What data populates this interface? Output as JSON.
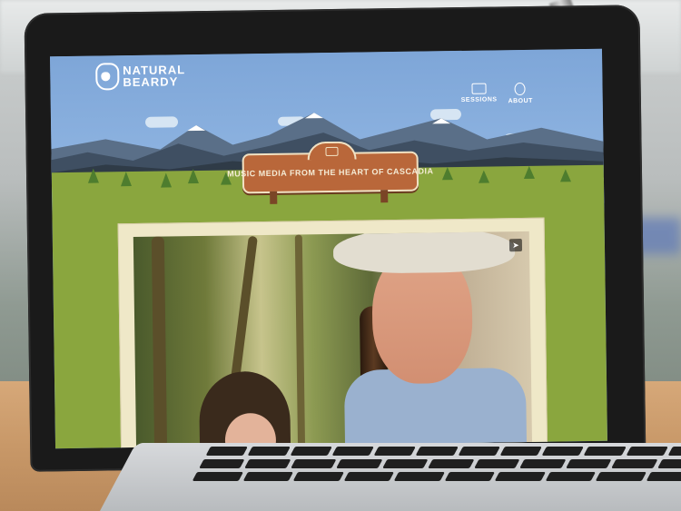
{
  "site": {
    "logo_line1": "NATURAL",
    "logo_line2": "BEARDY",
    "logo_icon": "beard-logo-icon"
  },
  "nav": {
    "items": [
      {
        "label": "SESSIONS",
        "icon": "tv-icon"
      },
      {
        "label": "ABOUT",
        "icon": "beard-icon"
      }
    ]
  },
  "banner": {
    "text": "MUSIC MEDIA FROM THE HEART OF CASCADIA",
    "icon": "camera-icon"
  },
  "video": {
    "share_icon": "share-icon"
  },
  "colors": {
    "sky": "#7ea6d8",
    "meadow": "#8aa63e",
    "banner": "#b9673a",
    "frame": "#efe8c8"
  }
}
